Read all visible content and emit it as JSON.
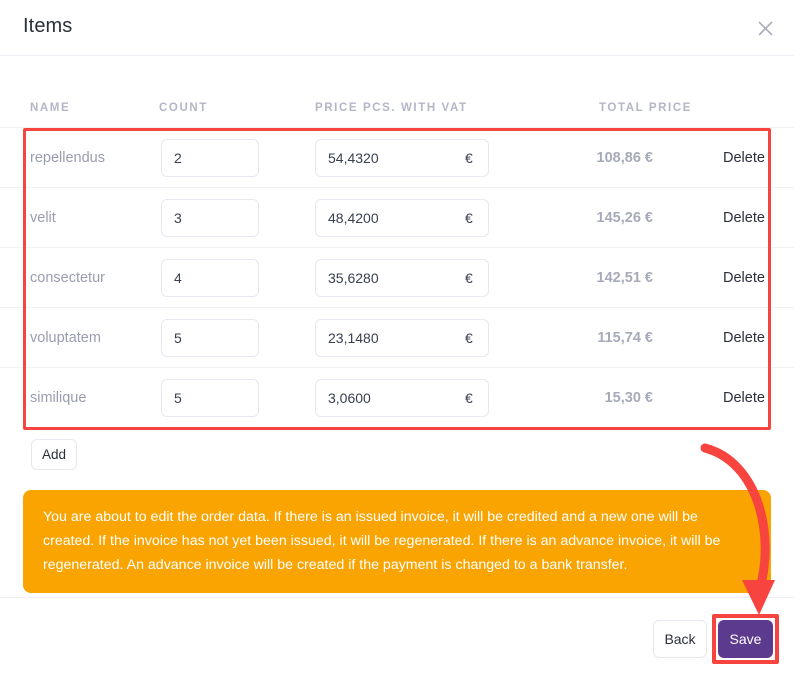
{
  "modal": {
    "title": "Items",
    "close_icon": "close-icon"
  },
  "table": {
    "columns": {
      "name": "NAME",
      "count": "COUNT",
      "price": "PRICE PCS. WITH VAT",
      "total": "TOTAL PRICE"
    },
    "currency_symbol": "€",
    "delete_label": "Delete",
    "rows": [
      {
        "name": "repellendus",
        "count": "2",
        "price": "54,4320",
        "total": "108,86 €"
      },
      {
        "name": "velit",
        "count": "3",
        "price": "48,4200",
        "total": "145,26 €"
      },
      {
        "name": "consectetur",
        "count": "4",
        "price": "35,6280",
        "total": "142,51 €"
      },
      {
        "name": "voluptatem",
        "count": "5",
        "price": "23,1480",
        "total": "115,74 €"
      },
      {
        "name": "similique",
        "count": "5",
        "price": "3,0600",
        "total": "15,30 €"
      }
    ]
  },
  "actions": {
    "add_label": "Add",
    "back_label": "Back",
    "save_label": "Save"
  },
  "warning": {
    "text": "You are about to edit the order data. If there is an issued invoice, it will be credited and a new one will be created. If the invoice has not yet been issued, it will be regenerated. If there is an advance invoice, it will be regenerated. An advance invoice will be created if the payment is changed to a bank transfer."
  },
  "annotations": {
    "highlight_color": "#f8443f",
    "arrow_color": "#f8443f",
    "banner_color": "#f9a400",
    "save_button_color": "#5c3b8e"
  }
}
